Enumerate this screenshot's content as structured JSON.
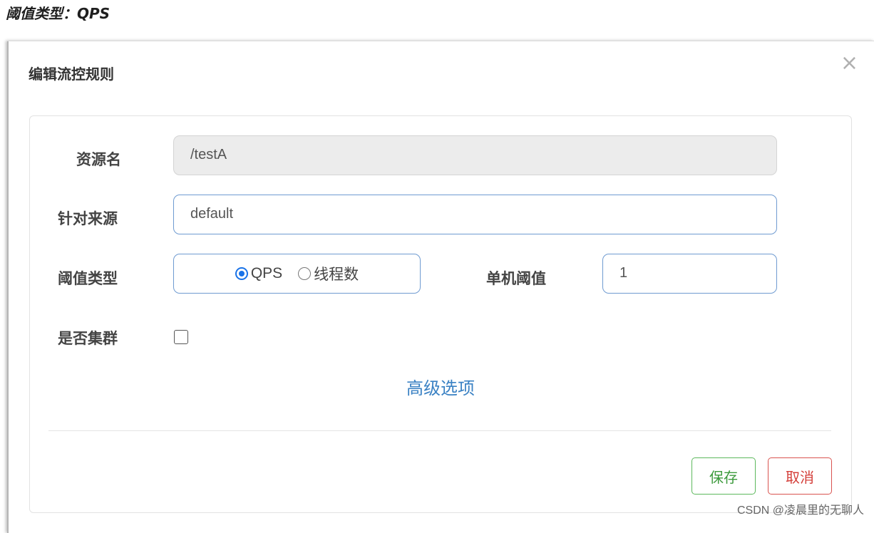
{
  "heading": "阈值类型：QPS",
  "dialog": {
    "title": "编辑流控规则",
    "close_icon": "×"
  },
  "form": {
    "resource": {
      "label": "资源名",
      "value": "/testA"
    },
    "limit_app": {
      "label": "针对来源",
      "value": "default"
    },
    "grade": {
      "label": "阈值类型",
      "options": [
        {
          "label": "QPS",
          "checked": true
        },
        {
          "label": "线程数",
          "checked": false
        }
      ]
    },
    "count": {
      "label": "单机阈值",
      "value": "1"
    },
    "cluster": {
      "label": "是否集群",
      "checked": false
    },
    "advanced_link": "高级选项"
  },
  "buttons": {
    "save": "保存",
    "cancel": "取消"
  },
  "watermark": "CSDN @凌晨里的无聊人",
  "colors": {
    "primary": "#1a73e8",
    "link": "#3b82c4",
    "save": "#5cb85c",
    "cancel": "#d9534f",
    "input_border": "#6f9bd1"
  }
}
